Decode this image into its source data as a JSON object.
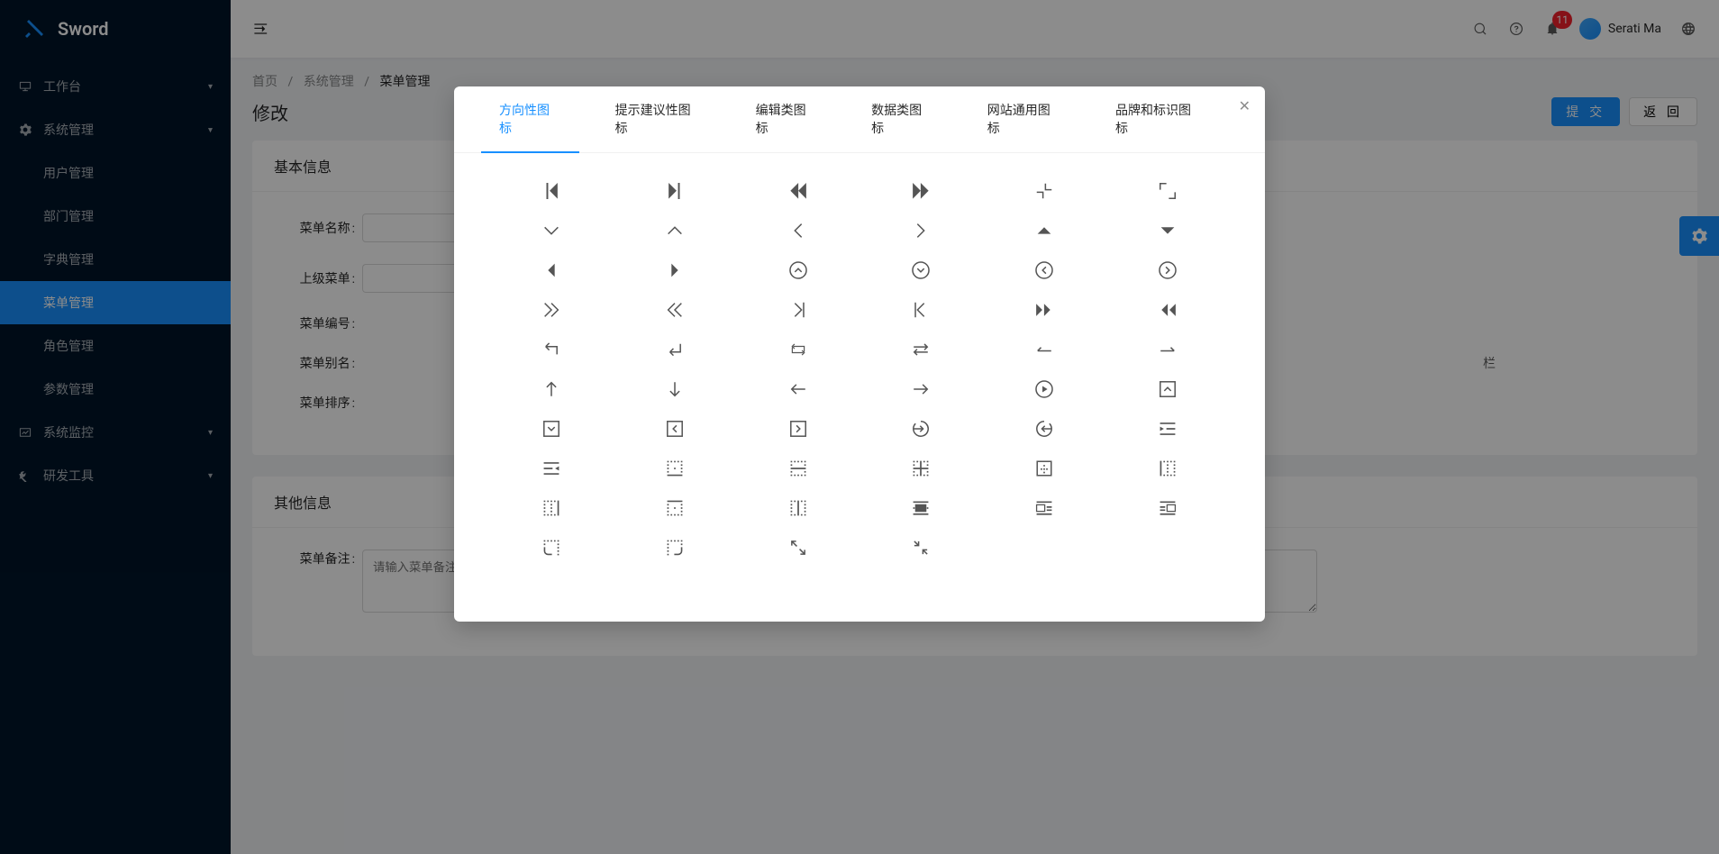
{
  "app": {
    "name": "Sword"
  },
  "sidebar": {
    "items": [
      {
        "label": "工作台",
        "icon": "desktop"
      },
      {
        "label": "系统管理",
        "icon": "setting",
        "open": true,
        "children": [
          {
            "label": "用户管理"
          },
          {
            "label": "部门管理"
          },
          {
            "label": "字典管理"
          },
          {
            "label": "菜单管理",
            "active": true
          },
          {
            "label": "角色管理"
          },
          {
            "label": "参数管理"
          }
        ]
      },
      {
        "label": "系统监控",
        "icon": "fund"
      },
      {
        "label": "研发工具",
        "icon": "tool"
      }
    ]
  },
  "header": {
    "badge": "11",
    "user_name": "Serati Ma"
  },
  "breadcrumb": {
    "items": [
      "首页",
      "系统管理",
      "菜单管理"
    ]
  },
  "page": {
    "title": "修改",
    "submit": "提 交",
    "back": "返 回"
  },
  "form": {
    "section1_title": "基本信息",
    "section2_title": "其他信息",
    "labels": {
      "name": "菜单名称",
      "parent": "上级菜单",
      "code": "菜单编号",
      "alias": "菜单别名",
      "sort": "菜单排序",
      "remark": "菜单备注"
    },
    "placeholders": {
      "remark": "请输入菜单备注"
    },
    "hint_tail": "栏"
  },
  "modal": {
    "tabs": [
      "方向性图标",
      "提示建议性图标",
      "编辑类图标",
      "数据类图标",
      "网站通用图标",
      "品牌和标识图标"
    ],
    "active_tab": 0,
    "icons": [
      "step-backward",
      "step-forward",
      "fast-backward",
      "fast-forward",
      "shrink",
      "arrows-alt",
      "down",
      "up",
      "left",
      "right",
      "caret-up",
      "caret-down",
      "caret-left",
      "caret-right",
      "up-circle",
      "down-circle",
      "left-circle",
      "right-circle",
      "double-right",
      "double-left",
      "vertical-left",
      "vertical-right",
      "forward",
      "backward",
      "rollback",
      "enter",
      "retweet",
      "swap",
      "swap-left",
      "swap-right",
      "arrow-up",
      "arrow-down",
      "arrow-left",
      "arrow-right",
      "play-circle",
      "up-square",
      "down-square",
      "left-square",
      "right-square",
      "login",
      "logout",
      "menu-fold",
      "menu-unfold",
      "border-bottom",
      "border-horizontal",
      "border-inner",
      "border-outer",
      "border-left",
      "border-right",
      "border-top",
      "border-verticle",
      "pic-center",
      "pic-left",
      "pic-right",
      "radius-bottomleft",
      "radius-bottomright",
      "fullscreen",
      "fullscreen-exit"
    ]
  }
}
